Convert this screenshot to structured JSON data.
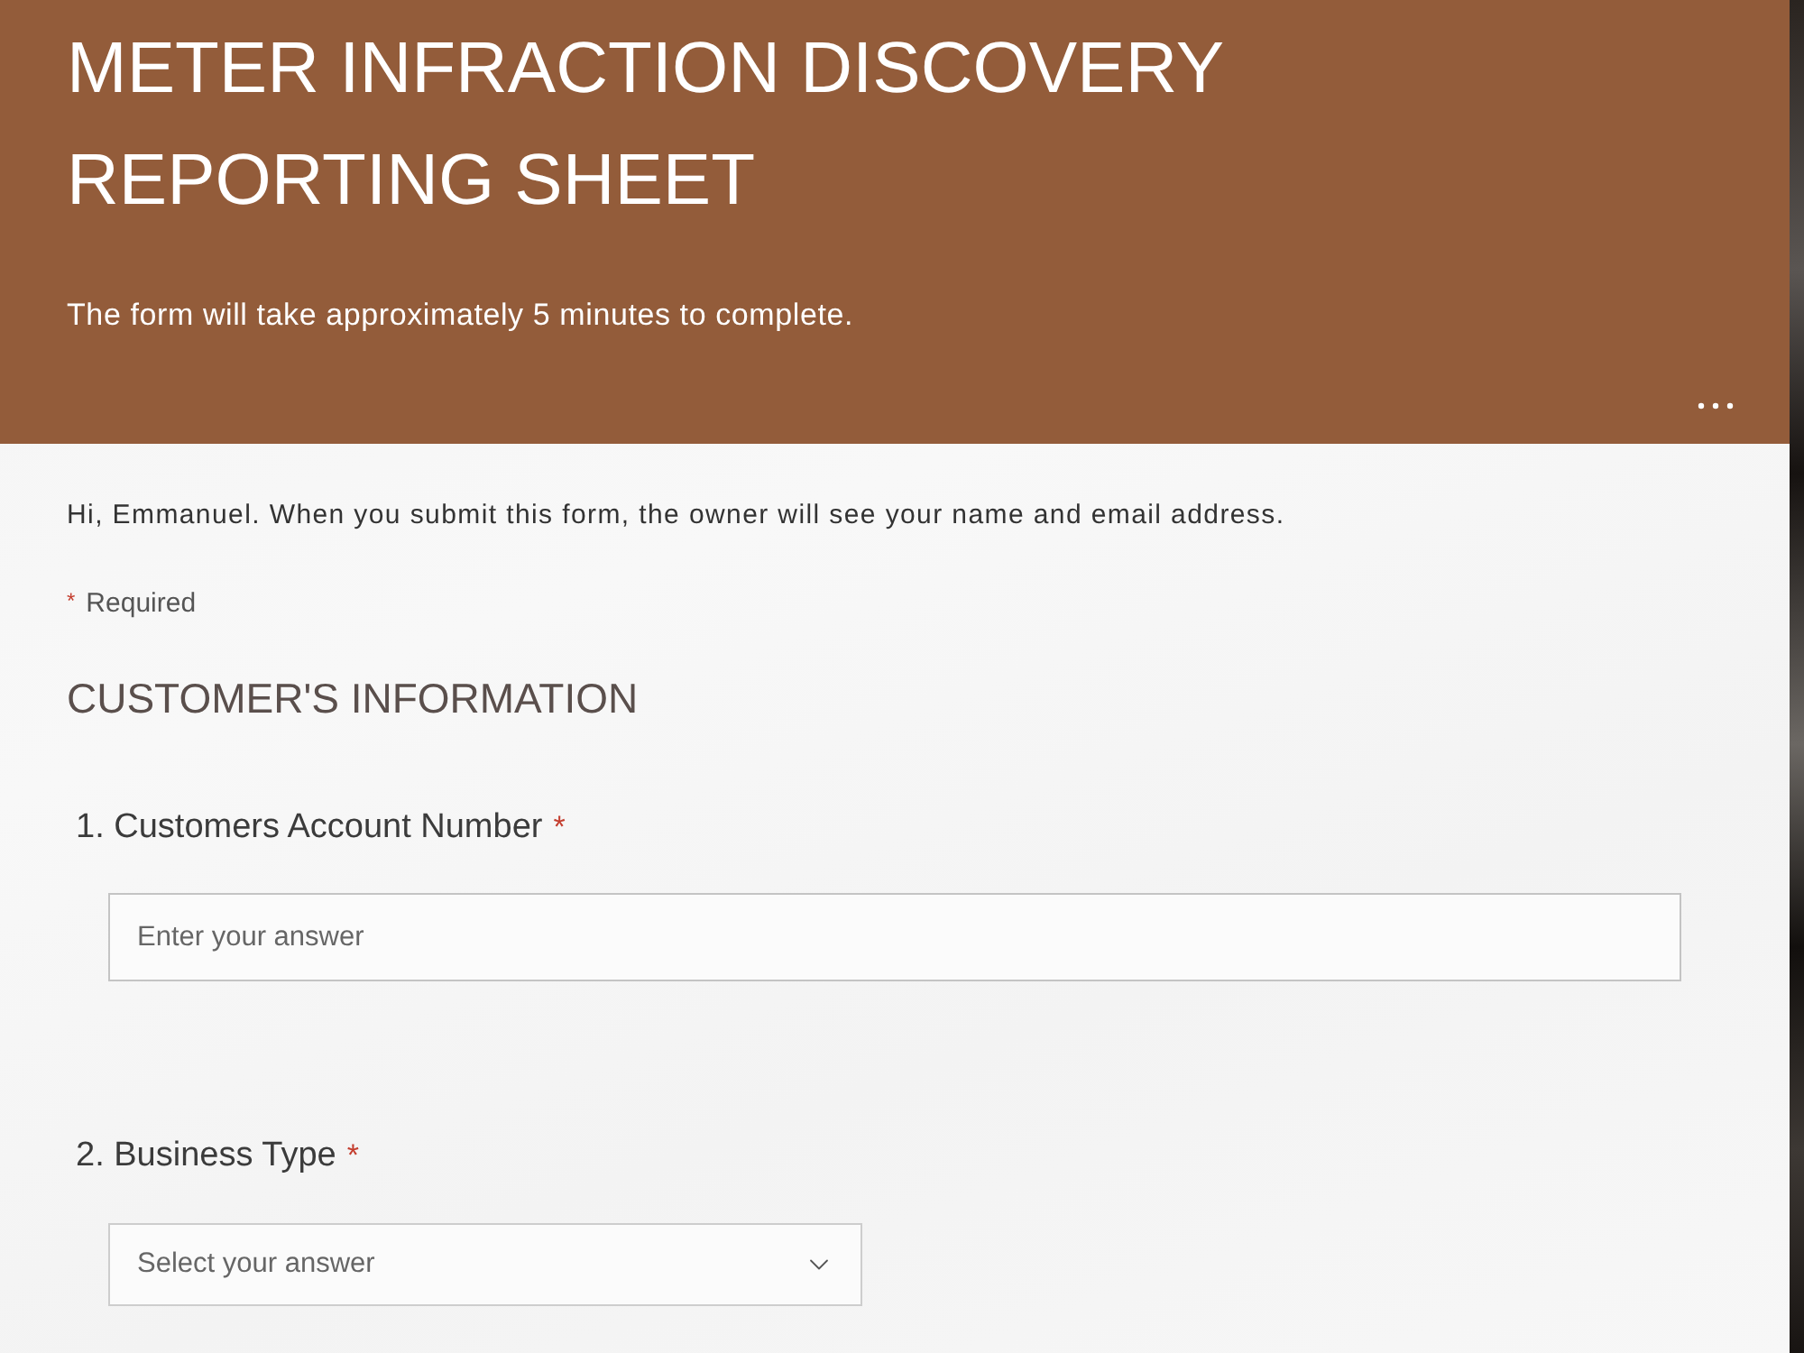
{
  "header": {
    "title": "METER INFRACTION DISCOVERY REPORTING SHEET",
    "subtitle": "The form will take approximately 5 minutes to complete."
  },
  "notice": "Hi, Emmanuel. When you submit this form, the owner will see your name and email address.",
  "required_note": {
    "mark": "*",
    "label": "Required"
  },
  "section": {
    "title": "CUSTOMER'S INFORMATION"
  },
  "questions": [
    {
      "number": "1.",
      "label": "Customers Account Number",
      "required": true,
      "kind": "text",
      "placeholder": "Enter your answer"
    },
    {
      "number": "2.",
      "label": "Business Type",
      "required": true,
      "kind": "choice",
      "placeholder": "Select your answer"
    }
  ]
}
